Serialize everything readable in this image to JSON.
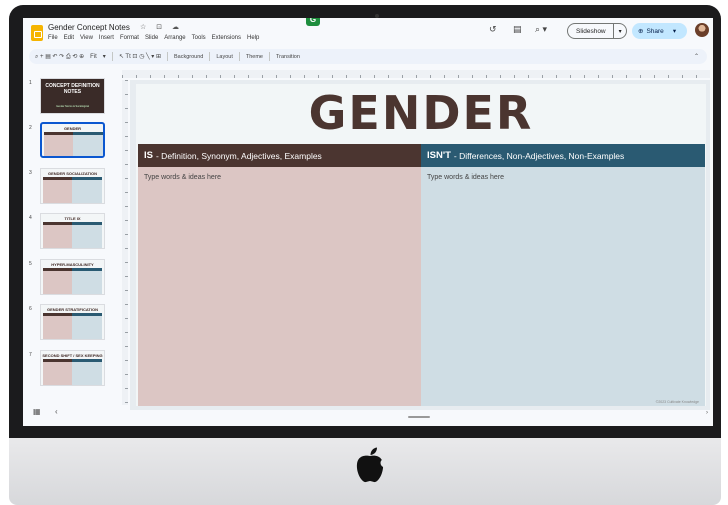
{
  "window": {
    "doc_title": "Gender Concept Notes",
    "title_icons": "☆ ⊡ ☁"
  },
  "menu": [
    "File",
    "Edit",
    "View",
    "Insert",
    "Format",
    "Slide",
    "Arrange",
    "Tools",
    "Extensions",
    "Help"
  ],
  "header_right": {
    "history_icon": "↺",
    "comments_icon": "▤",
    "meet_icon": "⌕ ▾",
    "slideshow_label": "Slideshow",
    "slideshow_dropdown": "▾",
    "share_label": "Share",
    "share_icon": "⊕",
    "share_dropdown": "▾"
  },
  "toolbar": {
    "icons_left": "⌕  +  ▤  ↶  ↷  ⎙  ⟲  ⊕",
    "zoom": "Fit",
    "zoom_dropdown": "▾",
    "tools": "↖ Tt ⊡ ◷ ╲ ▾ ⊞",
    "background_label": "Background",
    "layout_label": "Layout",
    "theme_label": "Theme",
    "transition_label": "Transition",
    "collapse_icon": "⌃"
  },
  "filmstrip": {
    "slides": [
      {
        "num": "1",
        "title": "CONCEPT DEFINITION NOTES",
        "subtitle": "Gender Norms & Sociological"
      },
      {
        "num": "2",
        "title": "GENDER"
      },
      {
        "num": "3",
        "title": "GENDER SOCIALIZATION"
      },
      {
        "num": "4",
        "title": "TITLE IX"
      },
      {
        "num": "5",
        "title": "HYPER-MASCULINITY"
      },
      {
        "num": "6",
        "title": "GENDER STRATIFICATION"
      },
      {
        "num": "7",
        "title": "SECOND SHIFT / SEX KEEPING"
      }
    ],
    "grid_icon": "▦",
    "collapse_icon": "‹"
  },
  "slide": {
    "title": "GENDER",
    "left": {
      "head_bold": "IS",
      "head_text": "- Definition, Synonym, Adjectives, Examples",
      "body": "Type words & ideas here"
    },
    "right": {
      "head_bold": "ISN'T",
      "head_text": "- Differences, Non-Adjectives, Non-Examples",
      "body": "Type words & ideas here"
    },
    "copyright": "©2023 Cultivate Knowledge"
  },
  "badge": "G",
  "scroll_right_icon": "›"
}
